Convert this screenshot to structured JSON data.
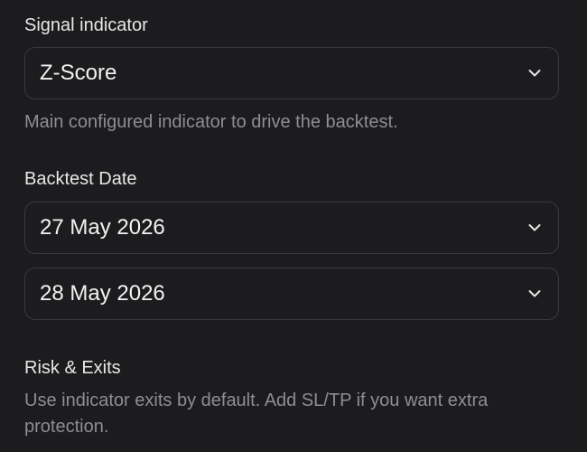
{
  "signal": {
    "label": "Signal indicator",
    "selected": "Z-Score",
    "help": "Main configured indicator to drive the backtest."
  },
  "backtest_date": {
    "label": "Backtest Date",
    "start": "27 May 2026",
    "end": "28 May 2026"
  },
  "risk": {
    "label": "Risk & Exits",
    "help": "Use indicator exits by default. Add SL/TP if you want extra protection."
  },
  "icons": {
    "dropdown": "chevron-down-icon"
  },
  "colors": {
    "background": "#1c1c1e",
    "border": "#3a3a3d",
    "text_primary": "#f2f2f2",
    "text_secondary": "#8e8e93"
  }
}
